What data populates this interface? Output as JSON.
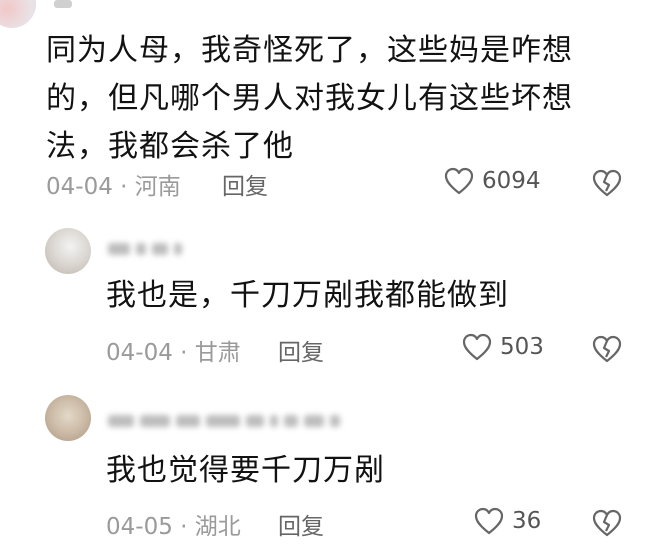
{
  "comments": [
    {
      "text": "同为人母，我奇怪死了，这些妈是咋想的，但凡哪个男人对我女儿有这些坏想法，我都会杀了他",
      "date": "04-04",
      "region": "河南",
      "reply_label": "回复",
      "likes": "6094"
    },
    {
      "text": "我也是，千刀万剐我都能做到",
      "date": "04-04",
      "region": "甘肃",
      "reply_label": "回复",
      "likes": "503"
    },
    {
      "text": "我也觉得要千刀万剐",
      "date": "04-05",
      "region": "湖北",
      "reply_label": "回复",
      "likes": "36"
    }
  ],
  "separator": "·",
  "colors": {
    "meta": "#9a9a9a",
    "text": "#121212",
    "icon": "#666666"
  },
  "icons": {
    "like": "heart-outline-icon",
    "dislike": "broken-heart-icon"
  }
}
